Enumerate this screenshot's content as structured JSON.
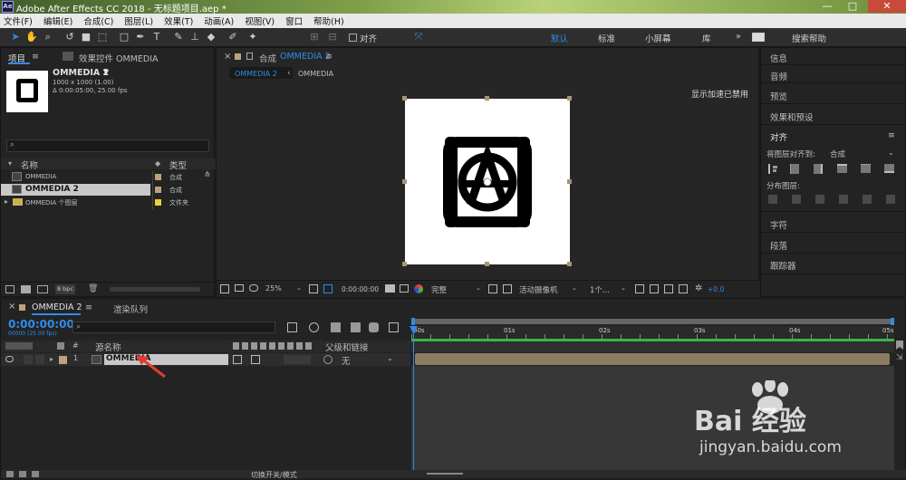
{
  "window": {
    "title": "Adobe After Effects CC 2018 - 无标题项目.aep *",
    "logo": "Ae",
    "minimize": "—",
    "maximize": "□",
    "close": "✕"
  },
  "menu": [
    "文件(F)",
    "编辑(E)",
    "合成(C)",
    "图层(L)",
    "效果(T)",
    "动画(A)",
    "视图(V)",
    "窗口",
    "帮助(H)"
  ],
  "toolbar": {
    "align_label": "对齐",
    "workspaces": [
      "默认",
      "标准",
      "小屏幕",
      "库"
    ],
    "active_workspace": "默认",
    "search_placeholder": "搜索帮助",
    "more": "»"
  },
  "project_panel": {
    "tab_project": "项目",
    "tab_effects": "效果控件 OMMEDIA",
    "comp_name": "OMMEDIA 2",
    "dims": "1000 x 1000 (1.00)",
    "duration": "Δ 0:00:05:00, 25.00 fps",
    "col_name": "名称",
    "col_type": "类型",
    "items": [
      {
        "name": "OMMEDIA",
        "type": "合成",
        "selected": false
      },
      {
        "name": "OMMEDIA 2",
        "type": "合成",
        "selected": true
      },
      {
        "name": "OMMEDIA 个图层",
        "type": "文件夹",
        "selected": false
      }
    ],
    "bpc": "8 bpc"
  },
  "comp_panel": {
    "tab_label": "合成",
    "tab_name": "OMMEDIA 2",
    "breadcrumb_active": "OMMEDIA 2",
    "breadcrumb_next": "OMMEDIA",
    "accel_notice": "显示加速已禁用",
    "zoom": "25%",
    "timecode": "0:00:00:00",
    "quality": "完整",
    "camera": "活动摄像机",
    "views": "1个...",
    "exposure": "+0.0"
  },
  "right_panel": {
    "items": [
      "信息",
      "音频",
      "预览",
      "效果和预设",
      "对齐"
    ],
    "align_to_label": "将图层对齐到:",
    "align_to_value": "合成",
    "distribute_label": "分布图层:",
    "bottom_items": [
      "字符",
      "段落",
      "跟踪器"
    ]
  },
  "timeline": {
    "tab_name": "OMMEDIA 2",
    "render_queue": "渲染队列",
    "timecode": "0:00:00:00",
    "timecode_sub": "00000 (25.00 fps)",
    "col_num": "#",
    "col_source": "源名称",
    "col_parent": "父级和链接",
    "layer": {
      "index": "1",
      "name": "OMMEDIA",
      "parent": "无"
    },
    "ruler": [
      "00s",
      "01s",
      "02s",
      "03s",
      "04s",
      "05s"
    ],
    "footer_toggle": "切换开关/模式"
  },
  "watermark": {
    "brand": "Bai 经验",
    "url": "jingyan.baidu.com"
  },
  "colors": {
    "accent": "#2d8ceb",
    "layer_bar": "#8b7c63",
    "green_bar": "#39b54a"
  }
}
